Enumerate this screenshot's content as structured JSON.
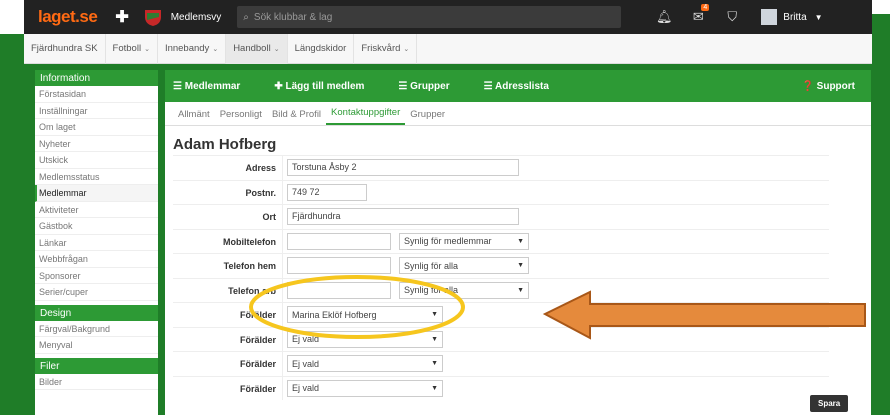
{
  "topbar": {
    "logo": "laget.se",
    "club_name": "Medlemsvy",
    "search_placeholder": "Sök klubbar & lag",
    "notification_badge": "4",
    "user": "Britta"
  },
  "subnav": {
    "items": [
      {
        "label": "Fjärdhundra SK",
        "has_caret": false
      },
      {
        "label": "Fotboll",
        "has_caret": true
      },
      {
        "label": "Innebandy",
        "has_caret": true
      },
      {
        "label": "Handboll",
        "has_caret": true
      },
      {
        "label": "Längdskidor",
        "has_caret": false
      },
      {
        "label": "Friskvård",
        "has_caret": true
      }
    ]
  },
  "sidebar": {
    "sections": [
      {
        "title": "Information",
        "items": [
          "Förstasidan",
          "Inställningar",
          "Om laget",
          "Nyheter",
          "Utskick",
          "Medlemsstatus",
          "Medlemmar",
          "Aktiviteter",
          "Gästbok",
          "Länkar",
          "Webbfrågan",
          "Sponsorer",
          "Serier/cuper"
        ]
      },
      {
        "title": "Design",
        "items": [
          "Färgval/Bakgrund",
          "Menyval"
        ]
      },
      {
        "title": "Filer",
        "items": [
          "Bilder"
        ]
      }
    ],
    "active_item": "Medlemmar"
  },
  "actionbar": {
    "members": "Medlemmar",
    "add_member": "Lägg till medlem",
    "groups": "Grupper",
    "address_list": "Adresslista",
    "support": "Support"
  },
  "tabs": [
    "Allmänt",
    "Personligt",
    "Bild & Profil",
    "Kontaktuppgifter",
    "Grupper"
  ],
  "active_tab": "Kontaktuppgifter",
  "person_name": "Adam Hofberg",
  "form": {
    "address_label": "Adress",
    "address_value": "Torstuna Åsby 2",
    "postnr_label": "Postnr.",
    "postnr_value": "749 72",
    "ort_label": "Ort",
    "ort_value": "Fjärdhundra",
    "mobile_label": "Mobiltelefon",
    "mobile_visibility": "Synlig för medlemmar",
    "home_label": "Telefon hem",
    "home_visibility": "Synlig för alla",
    "work_label": "Telefon arb",
    "work_visibility": "Synlig för alla",
    "parent_label": "Förälder",
    "parents": [
      "Marina Eklöf Hofberg",
      "Ej vald",
      "Ej vald",
      "Ej vald"
    ]
  },
  "save_button": "Spara",
  "colors": {
    "brand_green": "#2d9a35",
    "frame_green": "#1f7d28",
    "logo_orange": "#ff6a13",
    "highlight_yellow": "#f6c61e",
    "arrow_orange": "#e58a3c"
  }
}
